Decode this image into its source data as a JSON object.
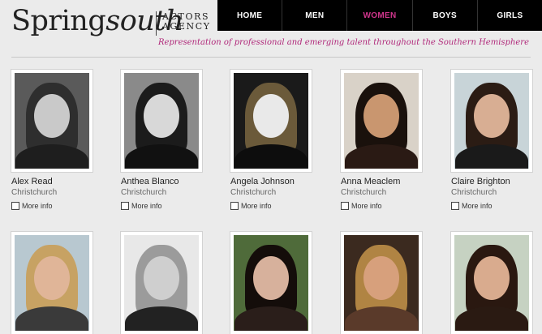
{
  "logo": {
    "main": "Spring",
    "main_italic": "south",
    "sub_line1": "ACTORS",
    "sub_line2": "AGENCY"
  },
  "nav": {
    "items": [
      {
        "label": "HOME"
      },
      {
        "label": "MEN"
      },
      {
        "label": "WOMEN",
        "active": true
      },
      {
        "label": "BOYS"
      },
      {
        "label": "GIRLS"
      }
    ]
  },
  "tagline": "Representation of professional and emerging talent throughout the Southern Hemisphere",
  "more_info_label": "More info",
  "colors": {
    "accent": "#d0358c",
    "nav_bg": "#000000",
    "page_bg": "#ebebeb"
  },
  "talent": [
    {
      "name": "Alex Read",
      "city": "Christchurch"
    },
    {
      "name": "Anthea Blanco",
      "city": "Christchurch"
    },
    {
      "name": "Angela Johnson",
      "city": "Christchurch"
    },
    {
      "name": "Anna Meaclem",
      "city": "Christchurch"
    },
    {
      "name": "Claire Brighton",
      "city": "Christchurch"
    },
    {
      "name": "",
      "city": ""
    },
    {
      "name": "",
      "city": ""
    },
    {
      "name": "",
      "city": ""
    },
    {
      "name": "",
      "city": ""
    },
    {
      "name": "",
      "city": ""
    }
  ]
}
